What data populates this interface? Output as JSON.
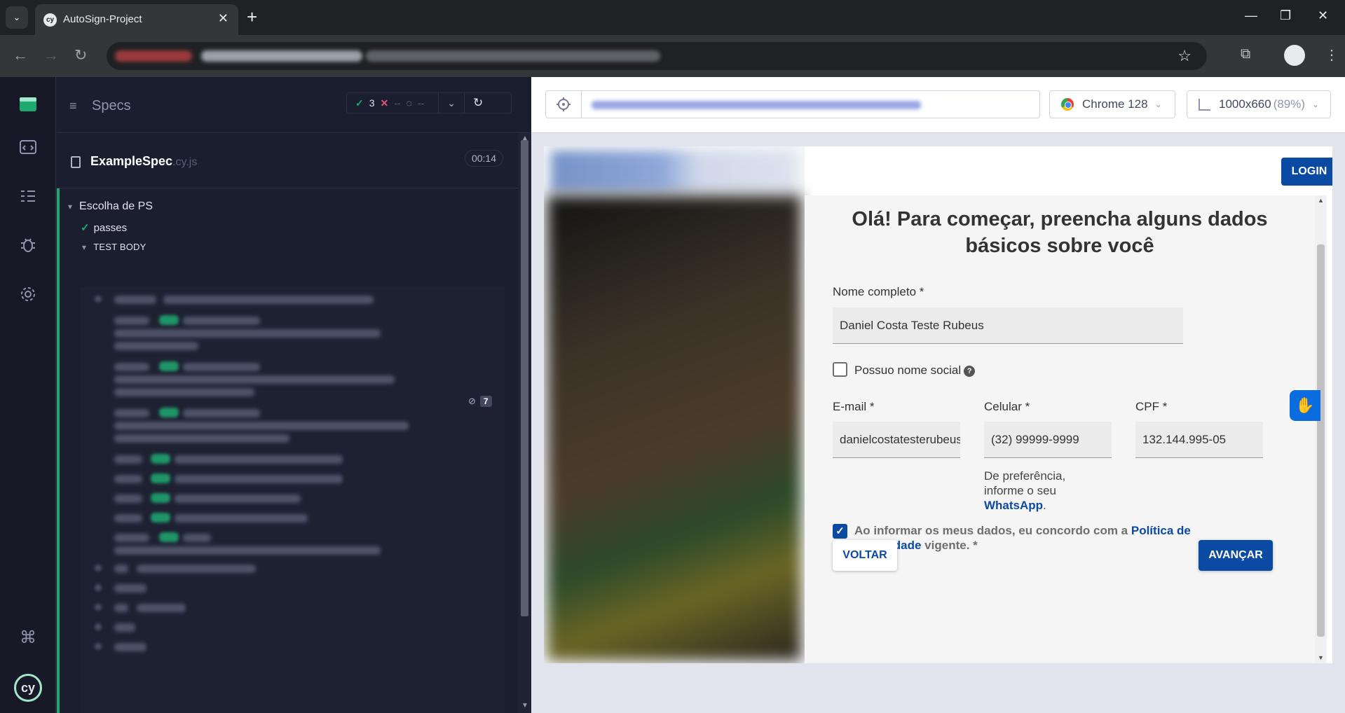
{
  "browser": {
    "tab_title": "AutoSign-Project",
    "tab_favicon": "cy",
    "tab_menu_icon": "chevron-down-icon",
    "new_tab_icon": "plus-icon",
    "minimize": "—",
    "maximize": "❐",
    "close": "✕"
  },
  "reporter": {
    "specs_label": "Specs",
    "stats": {
      "passed": "3",
      "failed": "--",
      "pending": "--"
    },
    "spec_name": "ExampleSpec",
    "spec_ext": ".cy.js",
    "duration": "00:14",
    "suite_title": "Escolha de PS",
    "test_title": "passes",
    "test_body_label": "TEST BODY",
    "hidden_count": "7"
  },
  "aut": {
    "browser_name": "Chrome 128",
    "viewport": "1000x660",
    "viewport_scale": "(89%)"
  },
  "app": {
    "login_label": "LOGIN",
    "title": "Olá! Para começar, preencha alguns dados básicos sobre você",
    "name_label": "Nome completo *",
    "name_value": "Daniel Costa Teste Rubeus",
    "social_name_label": "Possuo nome social",
    "email_label": "E-mail *",
    "email_value": "danielcostatesterubeus",
    "phone_label": "Celular *",
    "phone_value": "(32) 99999-9999",
    "cpf_label": "CPF *",
    "cpf_value": "132.144.995-05",
    "phone_hint_1": "De preferência,",
    "phone_hint_2": "informe o seu",
    "phone_hint_link": "WhatsApp",
    "consent_text_1": "Ao informar os meus dados, eu concordo com a ",
    "consent_link_1": "Política de",
    "consent_link_2": "Privacidade",
    "consent_text_2": " vigente. *",
    "back_label": "VOLTAR",
    "next_label": "AVANÇAR"
  },
  "colors": {
    "cypress_green": "#1fa971",
    "brand_blue": "#0b4aa2",
    "reporter_bg": "#1b1e2e"
  }
}
